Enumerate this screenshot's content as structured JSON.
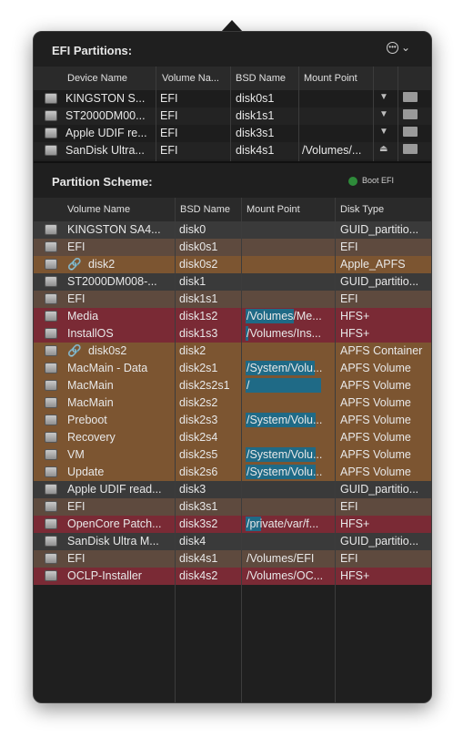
{
  "efi": {
    "title": "EFI Partitions:",
    "menu_icon": "ellipsis-circle-icon",
    "columns": [
      "Device Name",
      "Volume Na...",
      "BSD Name",
      "Mount Point"
    ],
    "rows": [
      {
        "device": "KINGSTON S...",
        "volume": "EFI",
        "bsd": "disk0s1",
        "mount": "",
        "action_icon": "mount-icon"
      },
      {
        "device": "ST2000DM00...",
        "volume": "EFI",
        "bsd": "disk1s1",
        "mount": "",
        "action_icon": "mount-icon"
      },
      {
        "device": "Apple UDIF re...",
        "volume": "EFI",
        "bsd": "disk3s1",
        "mount": "",
        "action_icon": "mount-icon"
      },
      {
        "device": "SanDisk Ultra...",
        "volume": "EFI",
        "bsd": "disk4s1",
        "mount": "/Volumes/...",
        "action_icon": "eject-icon"
      }
    ]
  },
  "scheme": {
    "title": "Partition Scheme:",
    "boot_label": "Boot EFI",
    "boot_color": "#2e8b3a",
    "columns": [
      "Volume Name",
      "BSD Name",
      "Mount Point",
      "Disk Type"
    ],
    "rows": [
      {
        "name": "KINGSTON SA4...",
        "bsd": "disk0",
        "mount": "",
        "type": "GUID_partitio...",
        "color": "#3a3a3a",
        "linked": false
      },
      {
        "name": "EFI",
        "bsd": "disk0s1",
        "mount": "",
        "type": "EFI",
        "color": "#5e4a3e",
        "linked": false
      },
      {
        "name": "disk2",
        "bsd": "disk0s2",
        "mount": "",
        "type": "Apple_APFS",
        "color": "#7c5531",
        "linked": true
      },
      {
        "name": "ST2000DM008-...",
        "bsd": "disk1",
        "mount": "",
        "type": "GUID_partitio...",
        "color": "#3a3a3a",
        "linked": false
      },
      {
        "name": "EFI",
        "bsd": "disk1s1",
        "mount": "",
        "type": "EFI",
        "color": "#5e4a3e",
        "linked": false
      },
      {
        "name": "Media",
        "bsd": "disk1s2",
        "mount": "/Volumes/Me...",
        "type": "HFS+",
        "color": "#7a2a35",
        "linked": false,
        "usage": 0.62
      },
      {
        "name": "InstallOS",
        "bsd": "disk1s3",
        "mount": "/Volumes/Ins...",
        "type": "HFS+",
        "color": "#7a2a35",
        "linked": false,
        "usage": 0.04
      },
      {
        "name": "disk0s2",
        "bsd": "disk2",
        "mount": "",
        "type": "APFS Container",
        "color": "#7c5531",
        "linked": true
      },
      {
        "name": "MacMain - Data",
        "bsd": "disk2s1",
        "mount": "/System/Volu...",
        "type": "APFS Volume",
        "color": "#7c5531",
        "linked": false,
        "usage": 0.88
      },
      {
        "name": "MacMain",
        "bsd": "disk2s2s1",
        "mount": "/",
        "type": "APFS Volume",
        "color": "#7c5531",
        "linked": false,
        "usage": 0.96
      },
      {
        "name": "MacMain",
        "bsd": "disk2s2",
        "mount": "",
        "type": "APFS Volume",
        "color": "#7c5531",
        "linked": false
      },
      {
        "name": "Preboot",
        "bsd": "disk2s3",
        "mount": "/System/Volu...",
        "type": "APFS Volume",
        "color": "#7c5531",
        "linked": false,
        "usage": 0.9
      },
      {
        "name": "Recovery",
        "bsd": "disk2s4",
        "mount": "",
        "type": "APFS Volume",
        "color": "#7c5531",
        "linked": false
      },
      {
        "name": "VM",
        "bsd": "disk2s5",
        "mount": "/System/Volu...",
        "type": "APFS Volume",
        "color": "#7c5531",
        "linked": false,
        "usage": 0.9
      },
      {
        "name": "Update",
        "bsd": "disk2s6",
        "mount": "/System/Volu...",
        "type": "APFS Volume",
        "color": "#7c5531",
        "linked": false,
        "usage": 0.9
      },
      {
        "name": "Apple UDIF read...",
        "bsd": "disk3",
        "mount": "",
        "type": "GUID_partitio...",
        "color": "#3a3a3a",
        "linked": false
      },
      {
        "name": "EFI",
        "bsd": "disk3s1",
        "mount": "",
        "type": "EFI",
        "color": "#5e4a3e",
        "linked": false
      },
      {
        "name": "OpenCore Patch...",
        "bsd": "disk3s2",
        "mount": "/private/var/f...",
        "type": "HFS+",
        "color": "#7a2a35",
        "linked": false,
        "usage": 0.2
      },
      {
        "name": "SanDisk Ultra M...",
        "bsd": "disk4",
        "mount": "",
        "type": "GUID_partitio...",
        "color": "#3a3a3a",
        "linked": false
      },
      {
        "name": "EFI",
        "bsd": "disk4s1",
        "mount": "/Volumes/EFI",
        "type": "EFI",
        "color": "#5e4a3e",
        "linked": false
      },
      {
        "name": "OCLP-Installer",
        "bsd": "disk4s2",
        "mount": "/Volumes/OC...",
        "type": "HFS+",
        "color": "#7a2a35",
        "linked": false
      }
    ]
  }
}
